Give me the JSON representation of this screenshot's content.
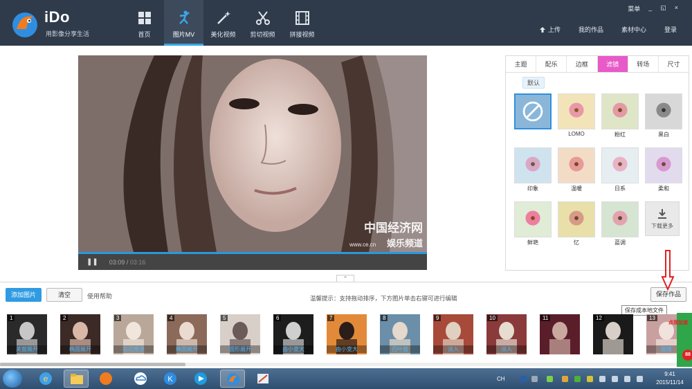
{
  "app": {
    "name": "iDo",
    "slogan": "用影像分享生活"
  },
  "nav": [
    {
      "label": "首页",
      "icon": "home-grid-icon",
      "active": false
    },
    {
      "label": "图片MV",
      "icon": "dancing-person-icon",
      "active": true
    },
    {
      "label": "美化视频",
      "icon": "magic-wand-icon",
      "active": false
    },
    {
      "label": "剪切视频",
      "icon": "scissors-icon",
      "active": false
    },
    {
      "label": "拼接视频",
      "icon": "film-strip-icon",
      "active": false
    }
  ],
  "window": {
    "menu": "菜单",
    "minimize": "_",
    "restore": "◱",
    "close": "×"
  },
  "top_links": {
    "upload": "上传",
    "my_works": "我的作品",
    "material_center": "素材中心",
    "login": "登录"
  },
  "player": {
    "current_time": "03:09",
    "separator": " / ",
    "total_time": "03:16",
    "progress_fraction": 1.0,
    "watermark_title": "中国经济网",
    "watermark_url": "www.ce.cn",
    "watermark_channel": "娱乐频道"
  },
  "panel": {
    "tabs": [
      "主题",
      "配乐",
      "边框",
      "滤镜",
      "转场",
      "尺寸"
    ],
    "active_tab": "滤镜",
    "default_chip": "默认",
    "filters": [
      {
        "label": "",
        "selected": true
      },
      {
        "label": "LOMO"
      },
      {
        "label": "粉红"
      },
      {
        "label": "黑白"
      },
      {
        "label": "印象"
      },
      {
        "label": "温暖"
      },
      {
        "label": "日系"
      },
      {
        "label": "柔和"
      },
      {
        "label": "鲜艳"
      },
      {
        "label": "忆"
      },
      {
        "label": "蓝调"
      },
      {
        "label": "下载更多",
        "download": true
      }
    ]
  },
  "toolbar": {
    "add_label": "添加图片",
    "clear_label": "清空",
    "help_label": "使用帮助",
    "tip": "温馨提示：支持拖动排序，下方图片单击右键可进行编辑",
    "save_label": "保存作品",
    "save_tooltip": "保存成本地文件"
  },
  "filmstrip": [
    {
      "num": "1",
      "effect": "关窗展开"
    },
    {
      "num": "2",
      "effect": "椭圆展开"
    },
    {
      "num": "3",
      "effect": "右边推进"
    },
    {
      "num": "4",
      "effect": "椭圆展开"
    },
    {
      "num": "5",
      "effect": "圆形展开"
    },
    {
      "num": "6",
      "effect": "由小变大"
    },
    {
      "num": "7",
      "effect": "由小变大"
    },
    {
      "num": "8",
      "effect": "百叶窗"
    },
    {
      "num": "9",
      "effect": "淡入"
    },
    {
      "num": "10",
      "effect": "淡入"
    },
    {
      "num": "11",
      "effect": ""
    },
    {
      "num": "12",
      "effect": ""
    },
    {
      "num": "13",
      "effect": "圆锥"
    }
  ],
  "promo": {
    "text": "点我加速",
    "badge": "88"
  },
  "taskbar": {
    "lang": "CH",
    "time": "9:41",
    "date": "2015/11/14"
  }
}
